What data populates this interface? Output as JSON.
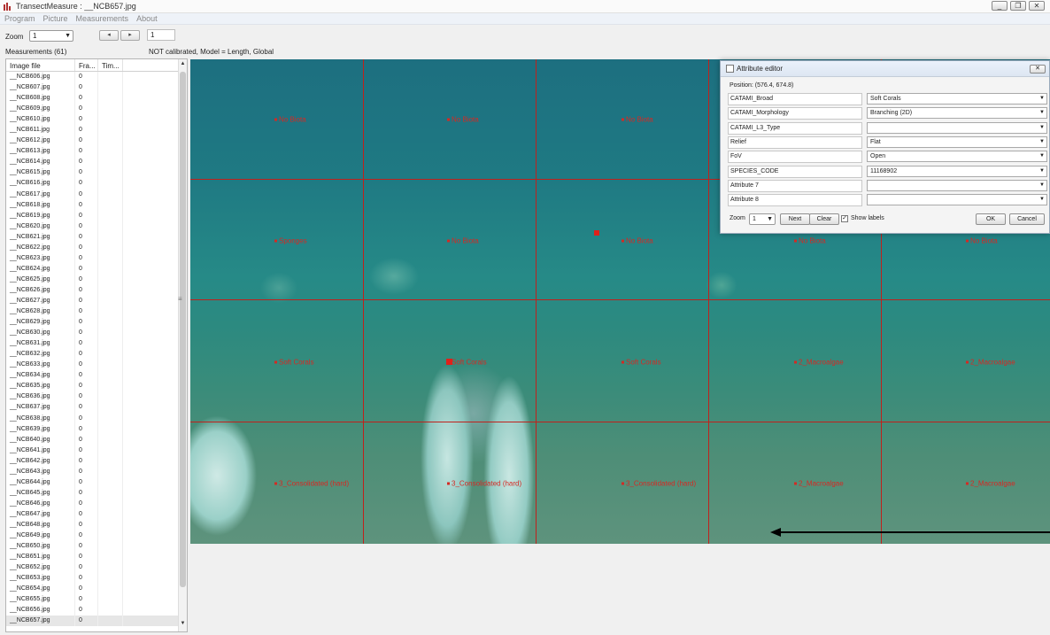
{
  "window": {
    "title": "TransectMeasure : __NCB657.jpg",
    "minimize": "_",
    "restore": "❐",
    "close": "✕"
  },
  "menu": [
    "Program",
    "Picture",
    "Measurements",
    "About"
  ],
  "toolbar": {
    "zoom_label": "Zoom",
    "zoom_value": "1",
    "prev": "◂",
    "next": "▸",
    "frame_value": "1"
  },
  "status": {
    "measurements_label": "Measurements (61)",
    "calibration": "NOT calibrated, Model = Length, Global"
  },
  "list": {
    "headers": [
      "Image file",
      "Fra...",
      "Tim..."
    ],
    "rows": [
      [
        "__NCB606.jpg",
        "0",
        ""
      ],
      [
        "__NCB607.jpg",
        "0",
        ""
      ],
      [
        "__NCB608.jpg",
        "0",
        ""
      ],
      [
        "__NCB609.jpg",
        "0",
        ""
      ],
      [
        "__NCB610.jpg",
        "0",
        ""
      ],
      [
        "__NCB611.jpg",
        "0",
        ""
      ],
      [
        "__NCB612.jpg",
        "0",
        ""
      ],
      [
        "__NCB613.jpg",
        "0",
        ""
      ],
      [
        "__NCB614.jpg",
        "0",
        ""
      ],
      [
        "__NCB615.jpg",
        "0",
        ""
      ],
      [
        "__NCB616.jpg",
        "0",
        ""
      ],
      [
        "__NCB617.jpg",
        "0",
        ""
      ],
      [
        "__NCB618.jpg",
        "0",
        ""
      ],
      [
        "__NCB619.jpg",
        "0",
        ""
      ],
      [
        "__NCB620.jpg",
        "0",
        ""
      ],
      [
        "__NCB621.jpg",
        "0",
        ""
      ],
      [
        "__NCB622.jpg",
        "0",
        ""
      ],
      [
        "__NCB623.jpg",
        "0",
        ""
      ],
      [
        "__NCB624.jpg",
        "0",
        ""
      ],
      [
        "__NCB625.jpg",
        "0",
        ""
      ],
      [
        "__NCB626.jpg",
        "0",
        ""
      ],
      [
        "__NCB627.jpg",
        "0",
        ""
      ],
      [
        "__NCB628.jpg",
        "0",
        ""
      ],
      [
        "__NCB629.jpg",
        "0",
        ""
      ],
      [
        "__NCB630.jpg",
        "0",
        ""
      ],
      [
        "__NCB631.jpg",
        "0",
        ""
      ],
      [
        "__NCB632.jpg",
        "0",
        ""
      ],
      [
        "__NCB633.jpg",
        "0",
        ""
      ],
      [
        "__NCB634.jpg",
        "0",
        ""
      ],
      [
        "__NCB635.jpg",
        "0",
        ""
      ],
      [
        "__NCB636.jpg",
        "0",
        ""
      ],
      [
        "__NCB637.jpg",
        "0",
        ""
      ],
      [
        "__NCB638.jpg",
        "0",
        ""
      ],
      [
        "__NCB639.jpg",
        "0",
        ""
      ],
      [
        "__NCB640.jpg",
        "0",
        ""
      ],
      [
        "__NCB641.jpg",
        "0",
        ""
      ],
      [
        "__NCB642.jpg",
        "0",
        ""
      ],
      [
        "__NCB643.jpg",
        "0",
        ""
      ],
      [
        "__NCB644.jpg",
        "0",
        ""
      ],
      [
        "__NCB645.jpg",
        "0",
        ""
      ],
      [
        "__NCB646.jpg",
        "0",
        ""
      ],
      [
        "__NCB647.jpg",
        "0",
        ""
      ],
      [
        "__NCB648.jpg",
        "0",
        ""
      ],
      [
        "__NCB649.jpg",
        "0",
        ""
      ],
      [
        "__NCB650.jpg",
        "0",
        ""
      ],
      [
        "__NCB651.jpg",
        "0",
        ""
      ],
      [
        "__NCB652.jpg",
        "0",
        ""
      ],
      [
        "__NCB653.jpg",
        "0",
        ""
      ],
      [
        "__NCB654.jpg",
        "0",
        ""
      ],
      [
        "__NCB655.jpg",
        "0",
        ""
      ],
      [
        "__NCB656.jpg",
        "0",
        ""
      ],
      [
        "__NCB657.jpg",
        "0",
        ""
      ]
    ]
  },
  "image": {
    "points": [
      [
        "No Biota",
        "No Biota",
        "No Biota",
        "",
        ""
      ],
      [
        "Sponges",
        "No Biota",
        "No Biota",
        "No Biota",
        "No Biota"
      ],
      [
        "Soft Corals",
        "Soft Corals",
        "Soft Corals",
        "2_Macroalgae",
        "2_Macroalgae"
      ],
      [
        "3_Consolidated (hard)",
        "3_Consolidated (hard)",
        "3_Consolidated (hard)",
        "2_Macroalgae",
        "2_Macroalgae"
      ]
    ]
  },
  "attribute_editor": {
    "title": "Attribute editor",
    "close": "✕",
    "position": "Position: (576.4, 674.8)",
    "rows": [
      {
        "name": "CATAMI_Broad",
        "value": "Soft Corals"
      },
      {
        "name": "CATAMI_Morphology",
        "value": "Branching (2D)"
      },
      {
        "name": "CATAMI_L3_Type",
        "value": ""
      },
      {
        "name": "Relief",
        "value": "Flat"
      },
      {
        "name": "FoV",
        "value": "Open"
      },
      {
        "name": "SPECIES_CODE",
        "value": "11168902"
      },
      {
        "name": "Attribute 7",
        "value": ""
      },
      {
        "name": "Attribute 8",
        "value": ""
      }
    ],
    "footer": {
      "zoom_label": "Zoom",
      "zoom_value": "1",
      "next": "Next",
      "clear": "Clear",
      "show_labels": "Show labels",
      "show_labels_checked": "✓",
      "ok": "OK",
      "cancel": "Cancel"
    }
  },
  "colors": {
    "grid": "#c0211c",
    "label": "#d42a24"
  }
}
